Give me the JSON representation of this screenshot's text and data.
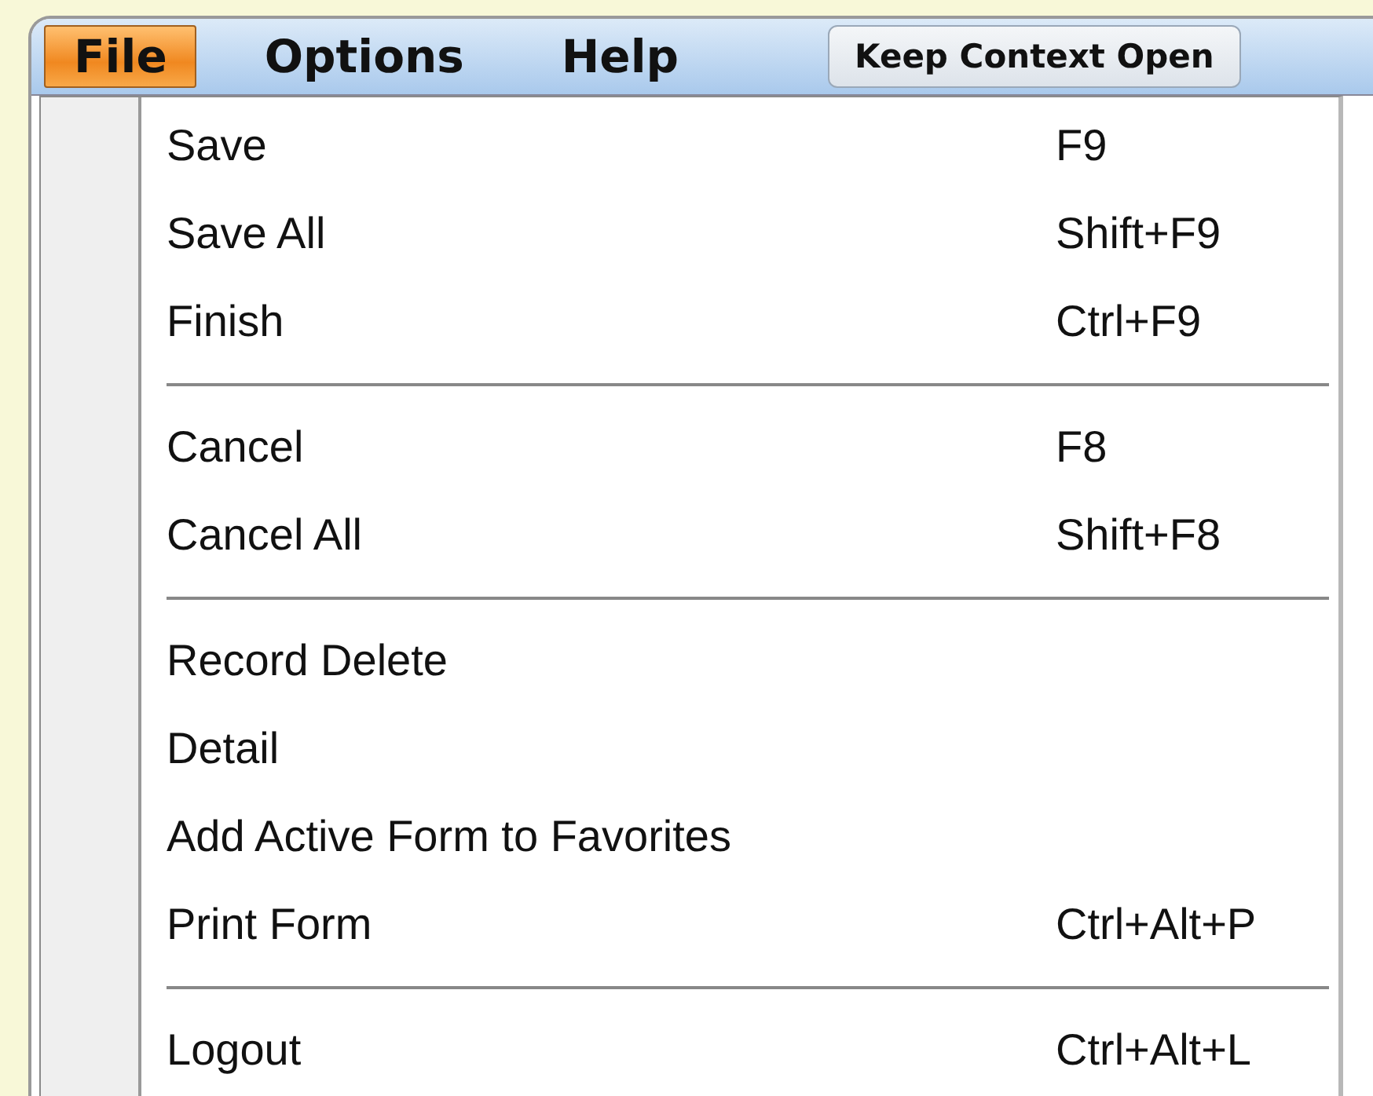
{
  "menubar": [
    {
      "label": "File",
      "selected": true
    },
    {
      "label": "Options",
      "selected": false
    },
    {
      "label": "Help",
      "selected": false
    }
  ],
  "context_button": {
    "label": "Keep Context Open"
  },
  "file_menu": [
    {
      "kind": "item",
      "label": "Save",
      "shortcut": "F9"
    },
    {
      "kind": "item",
      "label": "Save All",
      "shortcut": "Shift+F9"
    },
    {
      "kind": "item",
      "label": "Finish",
      "shortcut": "Ctrl+F9"
    },
    {
      "kind": "separator"
    },
    {
      "kind": "item",
      "label": "Cancel",
      "shortcut": "F8"
    },
    {
      "kind": "item",
      "label": "Cancel All",
      "shortcut": "Shift+F8"
    },
    {
      "kind": "separator"
    },
    {
      "kind": "item",
      "label": "Record Delete"
    },
    {
      "kind": "item",
      "label": "Detail"
    },
    {
      "kind": "item",
      "label": "Add Active Form to Favorites"
    },
    {
      "kind": "item",
      "label": "Print Form",
      "shortcut": "Ctrl+Alt+P"
    },
    {
      "kind": "separator"
    },
    {
      "kind": "item",
      "label": "Logout",
      "shortcut": "Ctrl+Alt+L"
    }
  ]
}
